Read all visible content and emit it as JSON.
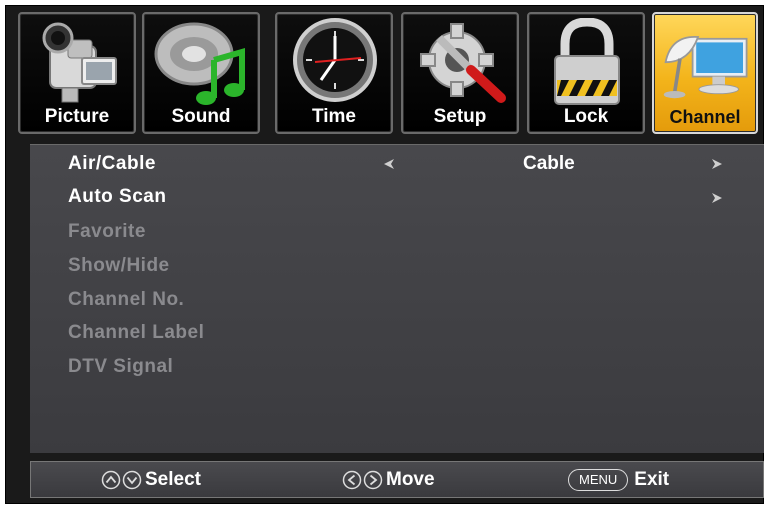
{
  "tabs": [
    {
      "label": "Picture",
      "icon": "camcorder-icon"
    },
    {
      "label": "Sound",
      "icon": "music-note-icon"
    },
    {
      "label": "Time",
      "icon": "clock-icon"
    },
    {
      "label": "Setup",
      "icon": "gear-wrench-icon"
    },
    {
      "label": "Lock",
      "icon": "padlock-icon"
    },
    {
      "label": "Channel",
      "icon": "satellite-dish-monitor-icon",
      "selected": true
    }
  ],
  "menu": {
    "items": [
      {
        "label": "Air/Cable",
        "value": "Cable",
        "enabled": true
      },
      {
        "label": "Auto Scan",
        "enabled": true
      },
      {
        "label": "Favorite",
        "enabled": false
      },
      {
        "label": "Show/Hide",
        "enabled": false
      },
      {
        "label": "Channel No.",
        "enabled": false
      },
      {
        "label": "Channel Label",
        "enabled": false
      },
      {
        "label": "DTV Signal",
        "enabled": false
      }
    ]
  },
  "hints": {
    "select": "Select",
    "move": "Move",
    "menu_key": "MENU",
    "exit": "Exit"
  },
  "colors": {
    "active_tab": "#f3b41b",
    "panel": "#424246",
    "disabled_text": "#8a8a8e"
  }
}
